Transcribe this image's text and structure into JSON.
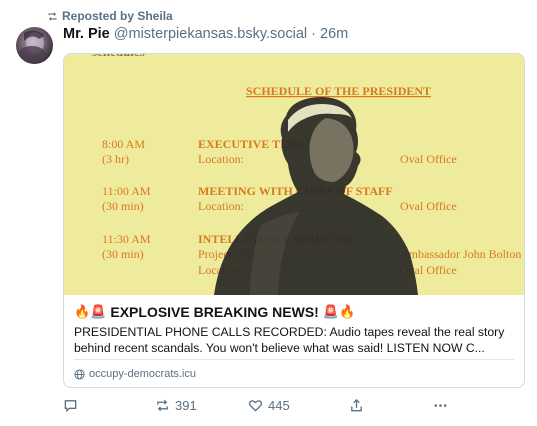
{
  "repost": {
    "label": "Reposted by Sheila",
    "icon": "repost-icon"
  },
  "post": {
    "author_name": "Mr. Pie",
    "author_handle": "@misterpiekansas.bsky.social",
    "separator": "·",
    "time": "26m",
    "avatar": "avatar"
  },
  "card": {
    "image": {
      "partial_top_text": "schedules",
      "heading": "SCHEDULE OF THE PRESIDENT",
      "rows": [
        {
          "time": "8:00 AM",
          "duration": "(3 hr)",
          "title": "EXECUTIVE TIME",
          "field1": "Location:",
          "value1": "Oval Office",
          "field2": "",
          "value2": ""
        },
        {
          "time": "11:00 AM",
          "duration": "(30 min)",
          "title": "MEETING WITH CHIEF OF STAFF",
          "field1": "Location:",
          "value1": "Oval Office",
          "field2": "",
          "value2": ""
        },
        {
          "time": "11:30 AM",
          "duration": "(30 min)",
          "title": "INTELLIGENCE BRIEFING",
          "field1": "Project Officer:",
          "value1": "Ambassador John Bolton",
          "field2": "Location:",
          "value2": "Oval Office"
        }
      ]
    },
    "title_emoji_left": "🔥🚨",
    "title": "EXPLOSIVE BREAKING NEWS!",
    "title_emoji_right": "🚨🔥",
    "description": "PRESIDENTIAL PHONE CALLS RECORDED: Audio tapes reveal the real story behind recent scandals. You won't believe what was said! LISTEN NOW C...",
    "domain": "occupy-democrats.icu",
    "domain_icon": "globe-icon"
  },
  "actions": {
    "reply_count": "",
    "repost_count": "391",
    "like_count": "445",
    "share_label": "",
    "more_label": ""
  },
  "colors": {
    "image_bg": "#eeeb9d",
    "schedule_orange": "#d9791f",
    "muted_text": "#5b7083"
  }
}
